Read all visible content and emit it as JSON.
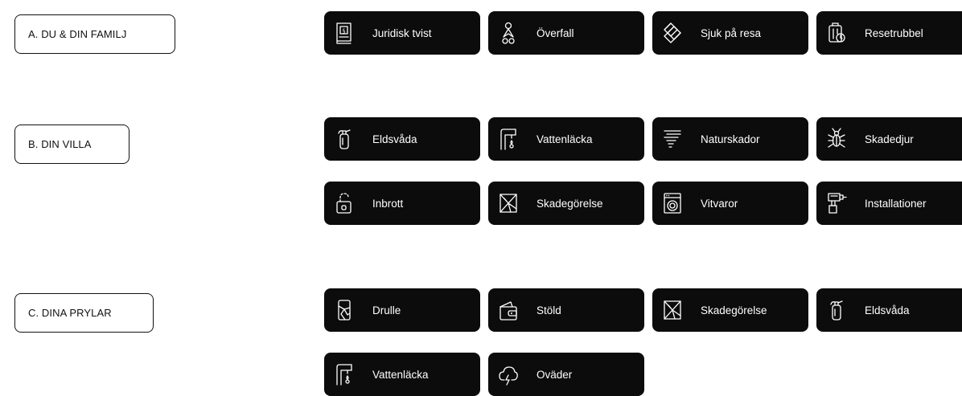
{
  "sections": [
    {
      "label": "A. DU & DIN FAMILJ",
      "items": [
        {
          "label": "Juridisk tvist",
          "icon": "law-book-icon"
        },
        {
          "label": "Överfall",
          "icon": "person-assault-icon"
        },
        {
          "label": "Sjuk på resa",
          "icon": "bandage-icon"
        },
        {
          "label": "Resetrubbel",
          "icon": "luggage-icon"
        }
      ]
    },
    {
      "label": "B. DIN VILLA",
      "items": [
        {
          "label": "Eldsvåda",
          "icon": "fire-extinguisher-icon"
        },
        {
          "label": "Vattenläcka",
          "icon": "water-tap-icon"
        },
        {
          "label": "Naturskador",
          "icon": "storm-lines-icon"
        },
        {
          "label": "Skadedjur",
          "icon": "insect-icon"
        },
        {
          "label": "Inbrott",
          "icon": "padlock-icon"
        },
        {
          "label": "Skadegörelse",
          "icon": "broken-window-icon"
        },
        {
          "label": "Vitvaror",
          "icon": "washing-machine-icon"
        },
        {
          "label": "Installationer",
          "icon": "drill-icon"
        }
      ]
    },
    {
      "label": "C. DINA PRYLAR",
      "items": [
        {
          "label": "Drulle",
          "icon": "cracked-phone-icon"
        },
        {
          "label": "Stöld",
          "icon": "wallet-icon"
        },
        {
          "label": "Skadegörelse",
          "icon": "broken-window-icon"
        },
        {
          "label": "Eldsvåda",
          "icon": "fire-extinguisher-icon"
        },
        {
          "label": "Vattenläcka",
          "icon": "water-tap-icon"
        },
        {
          "label": "Oväder",
          "icon": "thunder-cloud-icon"
        }
      ]
    }
  ],
  "colors": {
    "tile_background": "#0c0c0c",
    "tile_text": "#ffffff",
    "label_border": "#111111"
  }
}
